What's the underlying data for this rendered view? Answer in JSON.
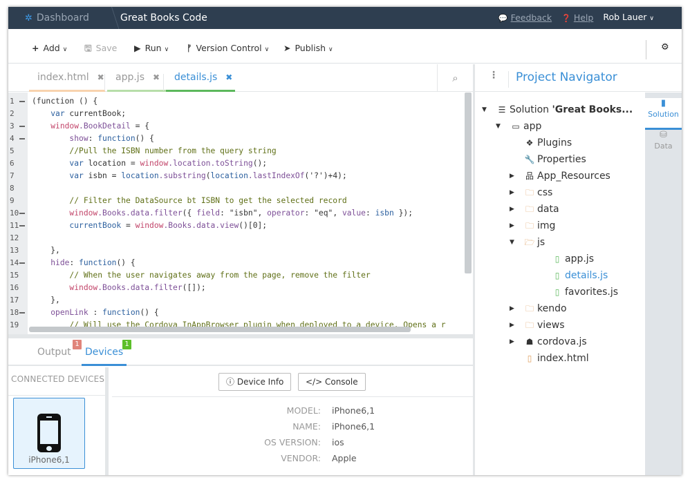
{
  "header": {
    "dashboard": "Dashboard",
    "project": "Great Books Code",
    "feedback": "Feedback",
    "help": "Help",
    "user": "Rob Lauer"
  },
  "toolbar": {
    "add": "Add",
    "save": "Save",
    "run": "Run",
    "version_control": "Version Control",
    "publish": "Publish"
  },
  "editor_tabs": [
    {
      "label": "index.html",
      "color": "#f8d3ae"
    },
    {
      "label": "app.js",
      "color": "#b7dea9"
    },
    {
      "label": "details.js",
      "color": "#5cb85c",
      "active": true
    }
  ],
  "code": [
    [
      [
        "i",
        "(function () {"
      ]
    ],
    [
      [
        "i",
        "    "
      ],
      [
        "k",
        "var"
      ],
      [
        "i",
        " currentBook;"
      ]
    ],
    [
      [
        "i",
        "    "
      ],
      [
        "w",
        "window"
      ],
      [
        "p",
        ".BookDetail"
      ],
      [
        "i",
        " = {"
      ]
    ],
    [
      [
        "i",
        "        "
      ],
      [
        "p",
        "show"
      ],
      [
        "i",
        ": "
      ],
      [
        "k",
        "function"
      ],
      [
        "i",
        "() {"
      ]
    ],
    [
      [
        "c",
        "        //Pull the ISBN number from the query string"
      ]
    ],
    [
      [
        "i",
        "        "
      ],
      [
        "k",
        "var"
      ],
      [
        "i",
        " location = "
      ],
      [
        "w",
        "window"
      ],
      [
        "p",
        ".location.toString"
      ],
      [
        "i",
        "();"
      ]
    ],
    [
      [
        "i",
        "        "
      ],
      [
        "k",
        "var"
      ],
      [
        "i",
        " isbn = "
      ],
      [
        "k",
        "location"
      ],
      [
        "p",
        ".substring"
      ],
      [
        "i",
        "("
      ],
      [
        "k",
        "location"
      ],
      [
        "p",
        ".lastIndexOf"
      ],
      [
        "i",
        "('?')+4);"
      ]
    ],
    [
      [
        "i",
        ""
      ]
    ],
    [
      [
        "c",
        "        // Filter the DataSource bt ISBN to get the selected record"
      ]
    ],
    [
      [
        "i",
        "        "
      ],
      [
        "w",
        "window"
      ],
      [
        "p",
        ".Books.data.filter"
      ],
      [
        "i",
        "({ "
      ],
      [
        "p",
        "field"
      ],
      [
        "i",
        ": \"isbn\", "
      ],
      [
        "p",
        "operator"
      ],
      [
        "i",
        ": \"eq\", "
      ],
      [
        "p",
        "value"
      ],
      [
        "i",
        ": "
      ],
      [
        "k",
        "isbn"
      ],
      [
        "i",
        " });"
      ]
    ],
    [
      [
        "i",
        "        "
      ],
      [
        "k",
        "currentBook"
      ],
      [
        "i",
        " = "
      ],
      [
        "w",
        "window"
      ],
      [
        "p",
        ".Books.data.view"
      ],
      [
        "i",
        "()[0];"
      ]
    ],
    [
      [
        "i",
        ""
      ]
    ],
    [
      [
        "i",
        "    },"
      ]
    ],
    [
      [
        "i",
        "    "
      ],
      [
        "p",
        "hide"
      ],
      [
        "i",
        ": "
      ],
      [
        "k",
        "function"
      ],
      [
        "i",
        "() {"
      ]
    ],
    [
      [
        "c",
        "        // When the user navigates away from the page, remove the filter"
      ]
    ],
    [
      [
        "i",
        "        "
      ],
      [
        "w",
        "window"
      ],
      [
        "p",
        ".Books.data.filter"
      ],
      [
        "i",
        "([]);"
      ]
    ],
    [
      [
        "i",
        "    },"
      ]
    ],
    [
      [
        "i",
        "    "
      ],
      [
        "p",
        "openLink"
      ],
      [
        "i",
        " : "
      ],
      [
        "k",
        "function"
      ],
      [
        "i",
        "() {"
      ]
    ],
    [
      [
        "c",
        "        // Will use the Cordova InAppBrowser plugin when deployed to a device. Opens a r"
      ]
    ]
  ],
  "foldable_lines": [
    1,
    3,
    4,
    10,
    11,
    14,
    18
  ],
  "bottom_tabs": {
    "output": "Output",
    "output_badge": "1",
    "devices": "Devices",
    "devices_badge": "1"
  },
  "devices": {
    "heading": "CONNECTED DEVICES",
    "device_name": "iPhone6,1",
    "device_info_button": "Device Info",
    "console_button": "Console",
    "properties": [
      {
        "label": "MODEL:",
        "value": "iPhone6,1"
      },
      {
        "label": "NAME:",
        "value": "iPhone6,1"
      },
      {
        "label": "OS VERSION:",
        "value": "ios"
      },
      {
        "label": "VENDOR:",
        "value": "Apple"
      }
    ]
  },
  "navigator": {
    "title": "Project Navigator",
    "side_tabs": [
      {
        "label": "Solution",
        "icon": "file-icon",
        "active": true
      },
      {
        "label": "Data",
        "icon": "database-icon"
      }
    ],
    "tree": [
      {
        "label": "Solution ",
        "bold": "'Great Books...",
        "level": 0,
        "caret": "open",
        "icon": "solution-icon"
      },
      {
        "label": "app",
        "level": 1,
        "caret": "open",
        "icon": "app-icon"
      },
      {
        "label": "Plugins",
        "level": 2,
        "icon": "plugins-icon"
      },
      {
        "label": "Properties",
        "level": 2,
        "icon": "wrench-icon"
      },
      {
        "label": "App_Resources",
        "level": 2,
        "caret": "closed",
        "icon": "sitemap-icon"
      },
      {
        "label": "css",
        "level": 2,
        "caret": "closed",
        "icon": "folder-icon"
      },
      {
        "label": "data",
        "level": 2,
        "caret": "closed",
        "icon": "folder-icon"
      },
      {
        "label": "img",
        "level": 2,
        "caret": "closed",
        "icon": "folder-icon"
      },
      {
        "label": "js",
        "level": 2,
        "caret": "open",
        "icon": "folder-open-icon"
      },
      {
        "label": "app.js",
        "level": 3,
        "icon": "js-file-icon"
      },
      {
        "label": "details.js",
        "level": 3,
        "icon": "js-file-icon",
        "selected": true
      },
      {
        "label": "favorites.js",
        "level": 3,
        "icon": "js-file-icon"
      },
      {
        "label": "kendo",
        "level": 2,
        "caret": "closed",
        "icon": "folder-icon"
      },
      {
        "label": "views",
        "level": 2,
        "caret": "closed",
        "icon": "folder-icon"
      },
      {
        "label": "cordova.js",
        "level": 2,
        "caret": "closed",
        "icon": "cordova-icon"
      },
      {
        "label": "index.html",
        "level": 2,
        "icon": "html-file-icon"
      }
    ]
  },
  "colors": {
    "header_bg": "#2e3e50",
    "accent": "#3a8fd6",
    "badge_output": "#e0847a",
    "badge_devices": "#5cbf2a"
  }
}
